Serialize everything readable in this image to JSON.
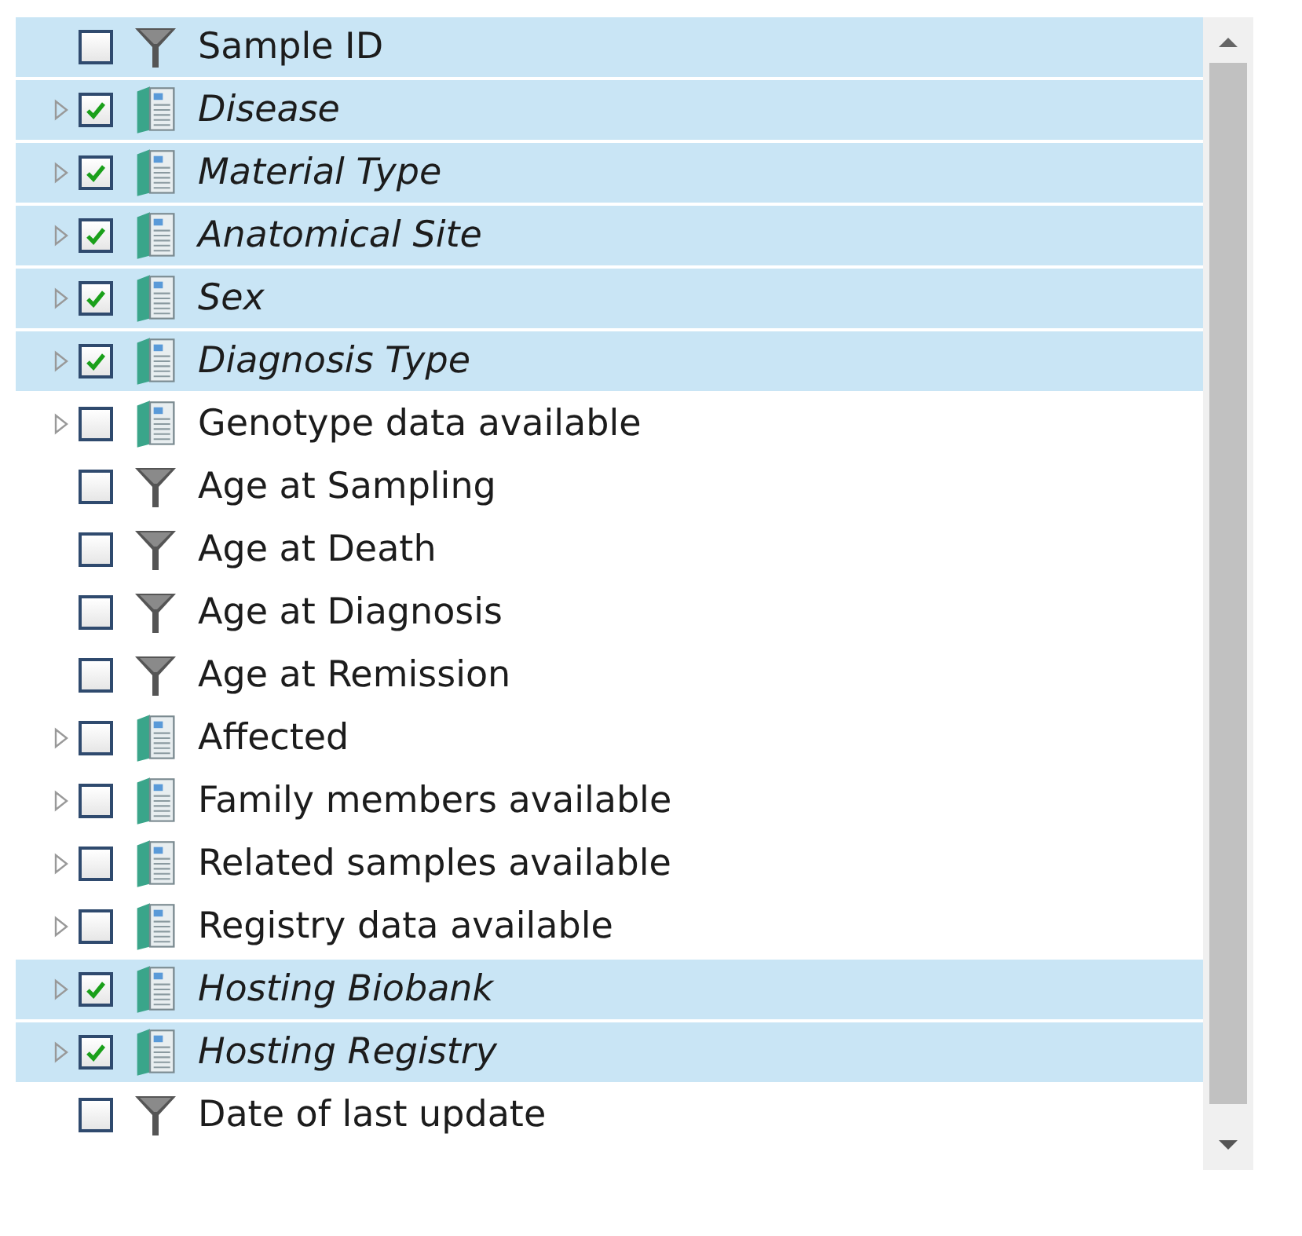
{
  "items": [
    {
      "kind": "filter",
      "label": "Sample ID",
      "checked": false,
      "selected": true
    },
    {
      "kind": "category",
      "label": "Disease",
      "checked": true,
      "selected": true,
      "expanded": false
    },
    {
      "kind": "category",
      "label": "Material Type",
      "checked": true,
      "selected": true,
      "expanded": false
    },
    {
      "kind": "category",
      "label": "Anatomical Site",
      "checked": true,
      "selected": true,
      "expanded": false
    },
    {
      "kind": "category",
      "label": "Sex",
      "checked": true,
      "selected": true,
      "expanded": false
    },
    {
      "kind": "category",
      "label": "Diagnosis Type",
      "checked": true,
      "selected": true,
      "expanded": false
    },
    {
      "kind": "category",
      "label": "Genotype data available",
      "checked": false,
      "selected": false,
      "expanded": false
    },
    {
      "kind": "filter",
      "label": "Age at Sampling",
      "checked": false,
      "selected": false
    },
    {
      "kind": "filter",
      "label": "Age at Death",
      "checked": false,
      "selected": false
    },
    {
      "kind": "filter",
      "label": "Age at Diagnosis",
      "checked": false,
      "selected": false
    },
    {
      "kind": "filter",
      "label": "Age at Remission",
      "checked": false,
      "selected": false
    },
    {
      "kind": "category",
      "label": "Affected",
      "checked": false,
      "selected": false,
      "expanded": false
    },
    {
      "kind": "category",
      "label": "Family members available",
      "checked": false,
      "selected": false,
      "expanded": false
    },
    {
      "kind": "category",
      "label": "Related samples available",
      "checked": false,
      "selected": false,
      "expanded": false
    },
    {
      "kind": "category",
      "label": "Registry data available",
      "checked": false,
      "selected": false,
      "expanded": false
    },
    {
      "kind": "category",
      "label": "Hosting Biobank",
      "checked": true,
      "selected": true,
      "expanded": false
    },
    {
      "kind": "category",
      "label": "Hosting Registry",
      "checked": true,
      "selected": true,
      "expanded": false
    },
    {
      "kind": "filter",
      "label": "Date of last update",
      "checked": false,
      "selected": false
    }
  ]
}
